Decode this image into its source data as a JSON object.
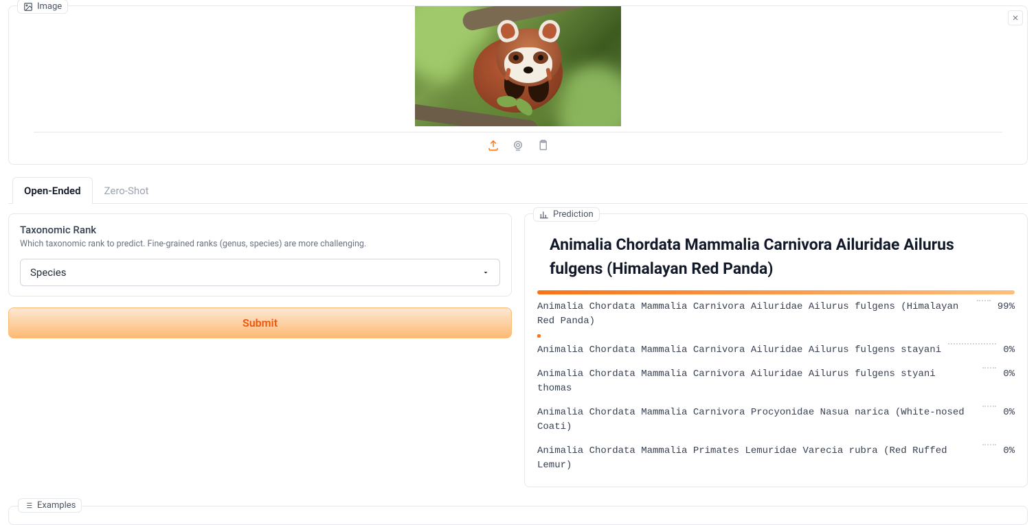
{
  "image_panel": {
    "label": "Image"
  },
  "tabs": {
    "open_ended": "Open-Ended",
    "zero_shot": "Zero-Shot"
  },
  "rank": {
    "title": "Taxonomic Rank",
    "subtitle": "Which taxonomic rank to predict. Fine-grained ranks (genus, species) are more challenging.",
    "value": "Species"
  },
  "submit_label": "Submit",
  "prediction_label": "Prediction",
  "prediction_title": "Animalia Chordata Mammalia Carnivora Ailuridae Ailurus fulgens (Himalayan Red Panda)",
  "predictions": [
    {
      "label": "Animalia Chordata Mammalia Carnivora Ailuridae Ailurus fulgens (Himalayan Red Panda)",
      "pct": "99%"
    },
    {
      "label": "Animalia Chordata Mammalia Carnivora Ailuridae Ailurus fulgens stayani",
      "pct": "0%"
    },
    {
      "label": "Animalia Chordata Mammalia Carnivora Ailuridae Ailurus fulgens styani thomas",
      "pct": "0%"
    },
    {
      "label": "Animalia Chordata Mammalia Carnivora Procyonidae Nasua narica (White-nosed Coati)",
      "pct": "0%"
    },
    {
      "label": "Animalia Chordata Mammalia Primates Lemuridae Varecia rubra (Red Ruffed Lemur)",
      "pct": "0%"
    }
  ],
  "examples_label": "Examples"
}
